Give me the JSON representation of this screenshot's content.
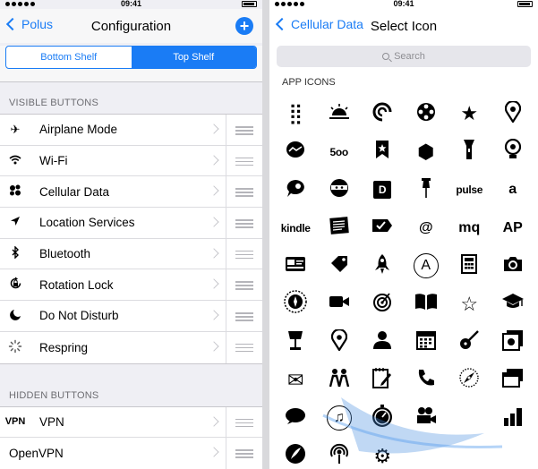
{
  "status_bar": {
    "time": "09:41"
  },
  "left": {
    "nav": {
      "back_label": "Polus",
      "title": "Configuration",
      "add_icon": "plus-circle-icon"
    },
    "segments": [
      {
        "label": "Bottom Shelf",
        "selected": false
      },
      {
        "label": "Top Shelf",
        "selected": true
      }
    ],
    "visible_header": "VISIBLE BUTTONS",
    "visible_items": [
      {
        "label": "Airplane Mode",
        "icon": "airplane-icon",
        "glyph": "✈"
      },
      {
        "label": "Wi-Fi",
        "icon": "wifi-icon",
        "glyph": ""
      },
      {
        "label": "Cellular Data",
        "icon": "cellular-icon",
        "glyph": ""
      },
      {
        "label": "Location Services",
        "icon": "location-arrow-icon",
        "glyph": "➤"
      },
      {
        "label": "Bluetooth",
        "icon": "bluetooth-icon",
        "glyph": "ᛒ"
      },
      {
        "label": "Rotation Lock",
        "icon": "rotation-lock-icon",
        "glyph": ""
      },
      {
        "label": "Do Not Disturb",
        "icon": "moon-icon",
        "glyph": "☾"
      },
      {
        "label": "Respring",
        "icon": "spinner-icon",
        "glyph": ""
      }
    ],
    "hidden_header": "HIDDEN BUTTONS",
    "hidden_items": [
      {
        "label": "VPN",
        "icon_text": "VPN"
      },
      {
        "label": "OpenVPN",
        "icon_text": ""
      }
    ]
  },
  "right": {
    "nav": {
      "back_label": "Cellular Data",
      "title": "Select Icon"
    },
    "search": {
      "placeholder": "Search"
    },
    "apps_header": "APP ICONS",
    "icons": [
      {
        "name": "dots-grid-icon",
        "glyph": "⣿"
      },
      {
        "name": "sunrise-icon",
        "glyph": ""
      },
      {
        "name": "swirl-icon",
        "glyph": ""
      },
      {
        "name": "film-reel-icon",
        "glyph": ""
      },
      {
        "name": "star-icon",
        "glyph": "★"
      },
      {
        "name": "map-pin-icon",
        "glyph": ""
      },
      {
        "name": "basecamp-icon",
        "glyph": ""
      },
      {
        "name": "500px-icon",
        "glyph": "5oo",
        "cls": "txt"
      },
      {
        "name": "bookmark-star-icon",
        "glyph": ""
      },
      {
        "name": "hexagon-logo-icon",
        "glyph": "⬢"
      },
      {
        "name": "flashlight-icon",
        "glyph": ""
      },
      {
        "name": "lightbulb-icon",
        "glyph": ""
      },
      {
        "name": "chat-bubble-icon",
        "glyph": ""
      },
      {
        "name": "ninja-icon",
        "glyph": ""
      },
      {
        "name": "d-box-icon",
        "glyph": "D",
        "cls": "box"
      },
      {
        "name": "pushpin-icon",
        "glyph": ""
      },
      {
        "name": "pulse-icon",
        "glyph": "pulse",
        "cls": "txt"
      },
      {
        "name": "amazon-icon",
        "glyph": "a",
        "cls": "txt-lg"
      },
      {
        "name": "kindle-icon",
        "glyph": "kindle",
        "cls": "txt"
      },
      {
        "name": "newspaper-icon",
        "glyph": ""
      },
      {
        "name": "tag-check-icon",
        "glyph": ""
      },
      {
        "name": "at-sign-icon",
        "glyph": "@",
        "cls": "txt-lg"
      },
      {
        "name": "mq-icon",
        "glyph": "mq",
        "cls": "txt-lg"
      },
      {
        "name": "ap-icon",
        "glyph": "AP",
        "cls": "txt-lg"
      },
      {
        "name": "id-card-icon",
        "glyph": ""
      },
      {
        "name": "price-tag-icon",
        "glyph": ""
      },
      {
        "name": "rocket-icon",
        "glyph": ""
      },
      {
        "name": "app-store-icon",
        "glyph": "A",
        "cls": "circ"
      },
      {
        "name": "calculator-icon",
        "glyph": ""
      },
      {
        "name": "camera-icon",
        "glyph": ""
      },
      {
        "name": "compass-badge-icon",
        "glyph": ""
      },
      {
        "name": "video-camera-icon",
        "glyph": ""
      },
      {
        "name": "dartboard-icon",
        "glyph": ""
      },
      {
        "name": "open-book-icon",
        "glyph": ""
      },
      {
        "name": "star-outline-icon",
        "glyph": "☆"
      },
      {
        "name": "graduation-cap-icon",
        "glyph": ""
      },
      {
        "name": "desk-lamp-icon",
        "glyph": ""
      },
      {
        "name": "location-pin-icon",
        "glyph": ""
      },
      {
        "name": "person-icon",
        "glyph": ""
      },
      {
        "name": "calendar-icon",
        "glyph": ""
      },
      {
        "name": "guitar-icon",
        "glyph": ""
      },
      {
        "name": "photo-stack-icon",
        "glyph": ""
      },
      {
        "name": "envelope-icon",
        "glyph": "✉"
      },
      {
        "name": "people-icon",
        "glyph": ""
      },
      {
        "name": "notepad-pencil-icon",
        "glyph": ""
      },
      {
        "name": "phone-icon",
        "glyph": ""
      },
      {
        "name": "compass-icon",
        "glyph": ""
      },
      {
        "name": "windows-stack-icon",
        "glyph": ""
      },
      {
        "name": "speech-bubble-icon",
        "glyph": ""
      },
      {
        "name": "music-note-icon",
        "glyph": "♫",
        "cls": "circ"
      },
      {
        "name": "stopwatch-icon",
        "glyph": ""
      },
      {
        "name": "movie-camera-icon",
        "glyph": ""
      },
      {
        "name": "hidden-icon-1",
        "glyph": ""
      },
      {
        "name": "bar-stack-icon",
        "glyph": ""
      },
      {
        "name": "quill-icon",
        "glyph": ""
      },
      {
        "name": "podcast-icon",
        "glyph": ""
      },
      {
        "name": "gear-icon",
        "glyph": "⚙"
      },
      {
        "name": "hidden-icon-2",
        "glyph": ""
      },
      {
        "name": "hidden-icon-3",
        "glyph": ""
      },
      {
        "name": "hidden-icon-4",
        "glyph": ""
      }
    ]
  },
  "colors": {
    "accent": "#1a7cf5",
    "group_bg": "#efeff4"
  }
}
